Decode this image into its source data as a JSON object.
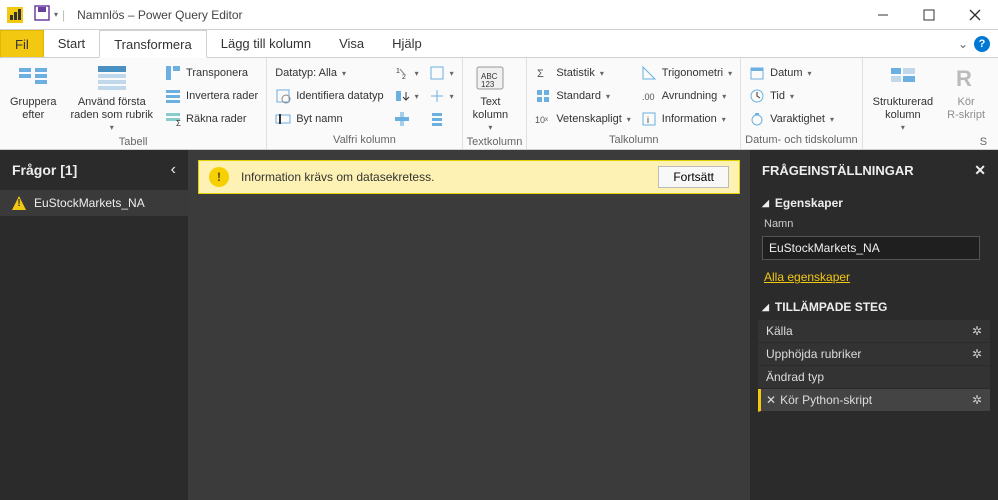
{
  "title": "Namnlös – Power Query Editor",
  "tabs": {
    "fil": "Fil",
    "start": "Start",
    "transform": "Transformera",
    "addcol": "Lägg till kolumn",
    "view": "Visa",
    "help": "Hjälp"
  },
  "ribbon": {
    "group_table": {
      "label": "Tabell",
      "groupby": "Gruppera\nefter",
      "headers": "Använd första\nraden som rubrik",
      "transpose": "Transponera",
      "reverse": "Invertera rader",
      "count": "Räkna rader"
    },
    "group_anycol": {
      "label": "Valfri kolumn",
      "datatype": "Datatyp: Alla",
      "detect": "Identifiera datatyp",
      "rename": "Byt namn"
    },
    "group_textcol": {
      "label": "Textkolumn",
      "textcol": "Text\nkolumn"
    },
    "group_numcol": {
      "label": "Talkolumn",
      "statistik": "Statistik",
      "standard": "Standard",
      "vetenskap": "Vetenskapligt",
      "trig": "Trigonometri",
      "avrund": "Avrundning",
      "info": "Information"
    },
    "group_datetime": {
      "label": "Datum- och tidskolumn",
      "datum": "Datum",
      "tid": "Tid",
      "varaktighet": "Varaktighet"
    },
    "group_struct": {
      "label": "S",
      "structcol": "Strukturerad\nkolumn",
      "rscript": "Kör\nR-skript"
    }
  },
  "queries": {
    "header": "Frågor [1]",
    "items": [
      "EuStockMarkets_NA"
    ]
  },
  "infobar": {
    "message": "Information krävs om datasekretess.",
    "button": "Fortsätt"
  },
  "settings": {
    "header": "FRÅGEINSTÄLLNINGAR",
    "props_section": "Egenskaper",
    "name_label": "Namn",
    "name_value": "EuStockMarkets_NA",
    "all_props": "Alla egenskaper",
    "steps_section": "TILLÄMPADE STEG",
    "steps": [
      {
        "label": "Källa",
        "gear": true
      },
      {
        "label": "Upphöjda rubriker",
        "gear": true
      },
      {
        "label": "Ändrad typ",
        "gear": false
      },
      {
        "label": "Kör Python-skript",
        "gear": true,
        "active": true,
        "deletable": true
      }
    ]
  }
}
